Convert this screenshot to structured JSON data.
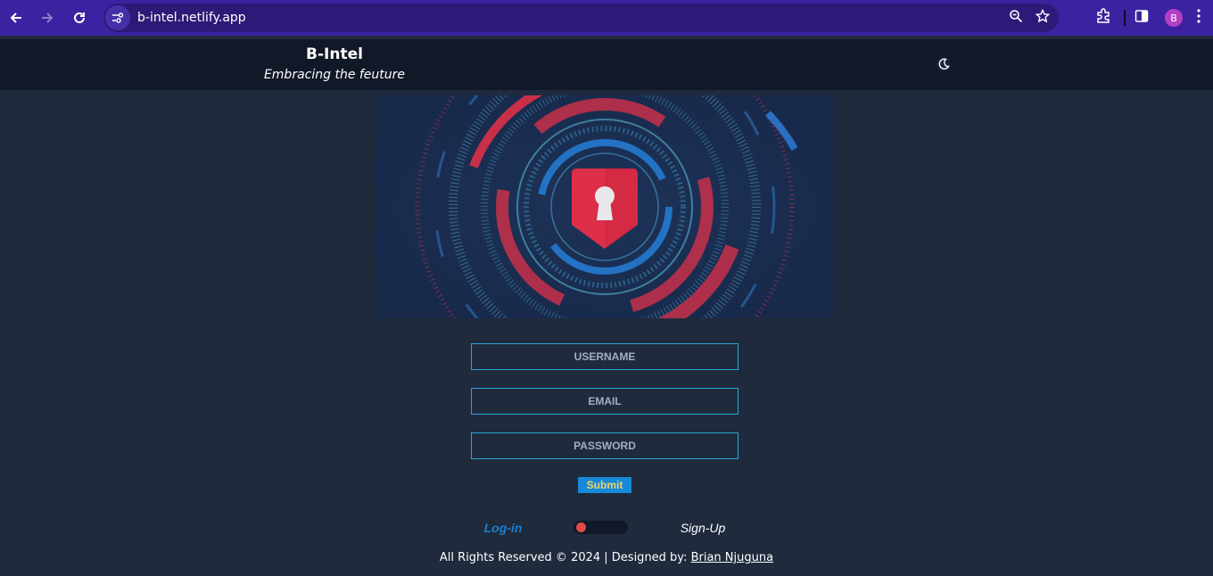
{
  "browser": {
    "url": "b-intel.netlify.app",
    "profile_initial": "B",
    "icons": [
      "back-icon",
      "forward-icon",
      "reload-icon",
      "site-info-icon",
      "zoom-icon",
      "bookmark-star-icon",
      "extensions-icon",
      "side-panel-icon",
      "more-menu-icon"
    ]
  },
  "header": {
    "title": "B-Intel",
    "subtitle": "Embracing the feuture",
    "theme_icon": "moon-icon"
  },
  "form": {
    "username_placeholder": "USERNAME",
    "email_placeholder": "EMAIL",
    "password_placeholder": "PASSWORD",
    "submit_label": "Submit"
  },
  "auth_toggle": {
    "login_label": "Log-in",
    "signup_label": "Sign-Up"
  },
  "footer": {
    "text": "All Rights Reserved © 2024 | Designed by: ",
    "designer": "Brian Njuguna"
  },
  "colors": {
    "chrome_bg": "#3b22a0",
    "page_bg": "#1f2a3c",
    "header_bg": "#111827",
    "input_border": "#2aa7d8",
    "submit_bg": "#1689d8",
    "submit_text": "#f3d36b",
    "login_link": "#1a7fd0",
    "toggle_knob": "#e04a4a"
  }
}
